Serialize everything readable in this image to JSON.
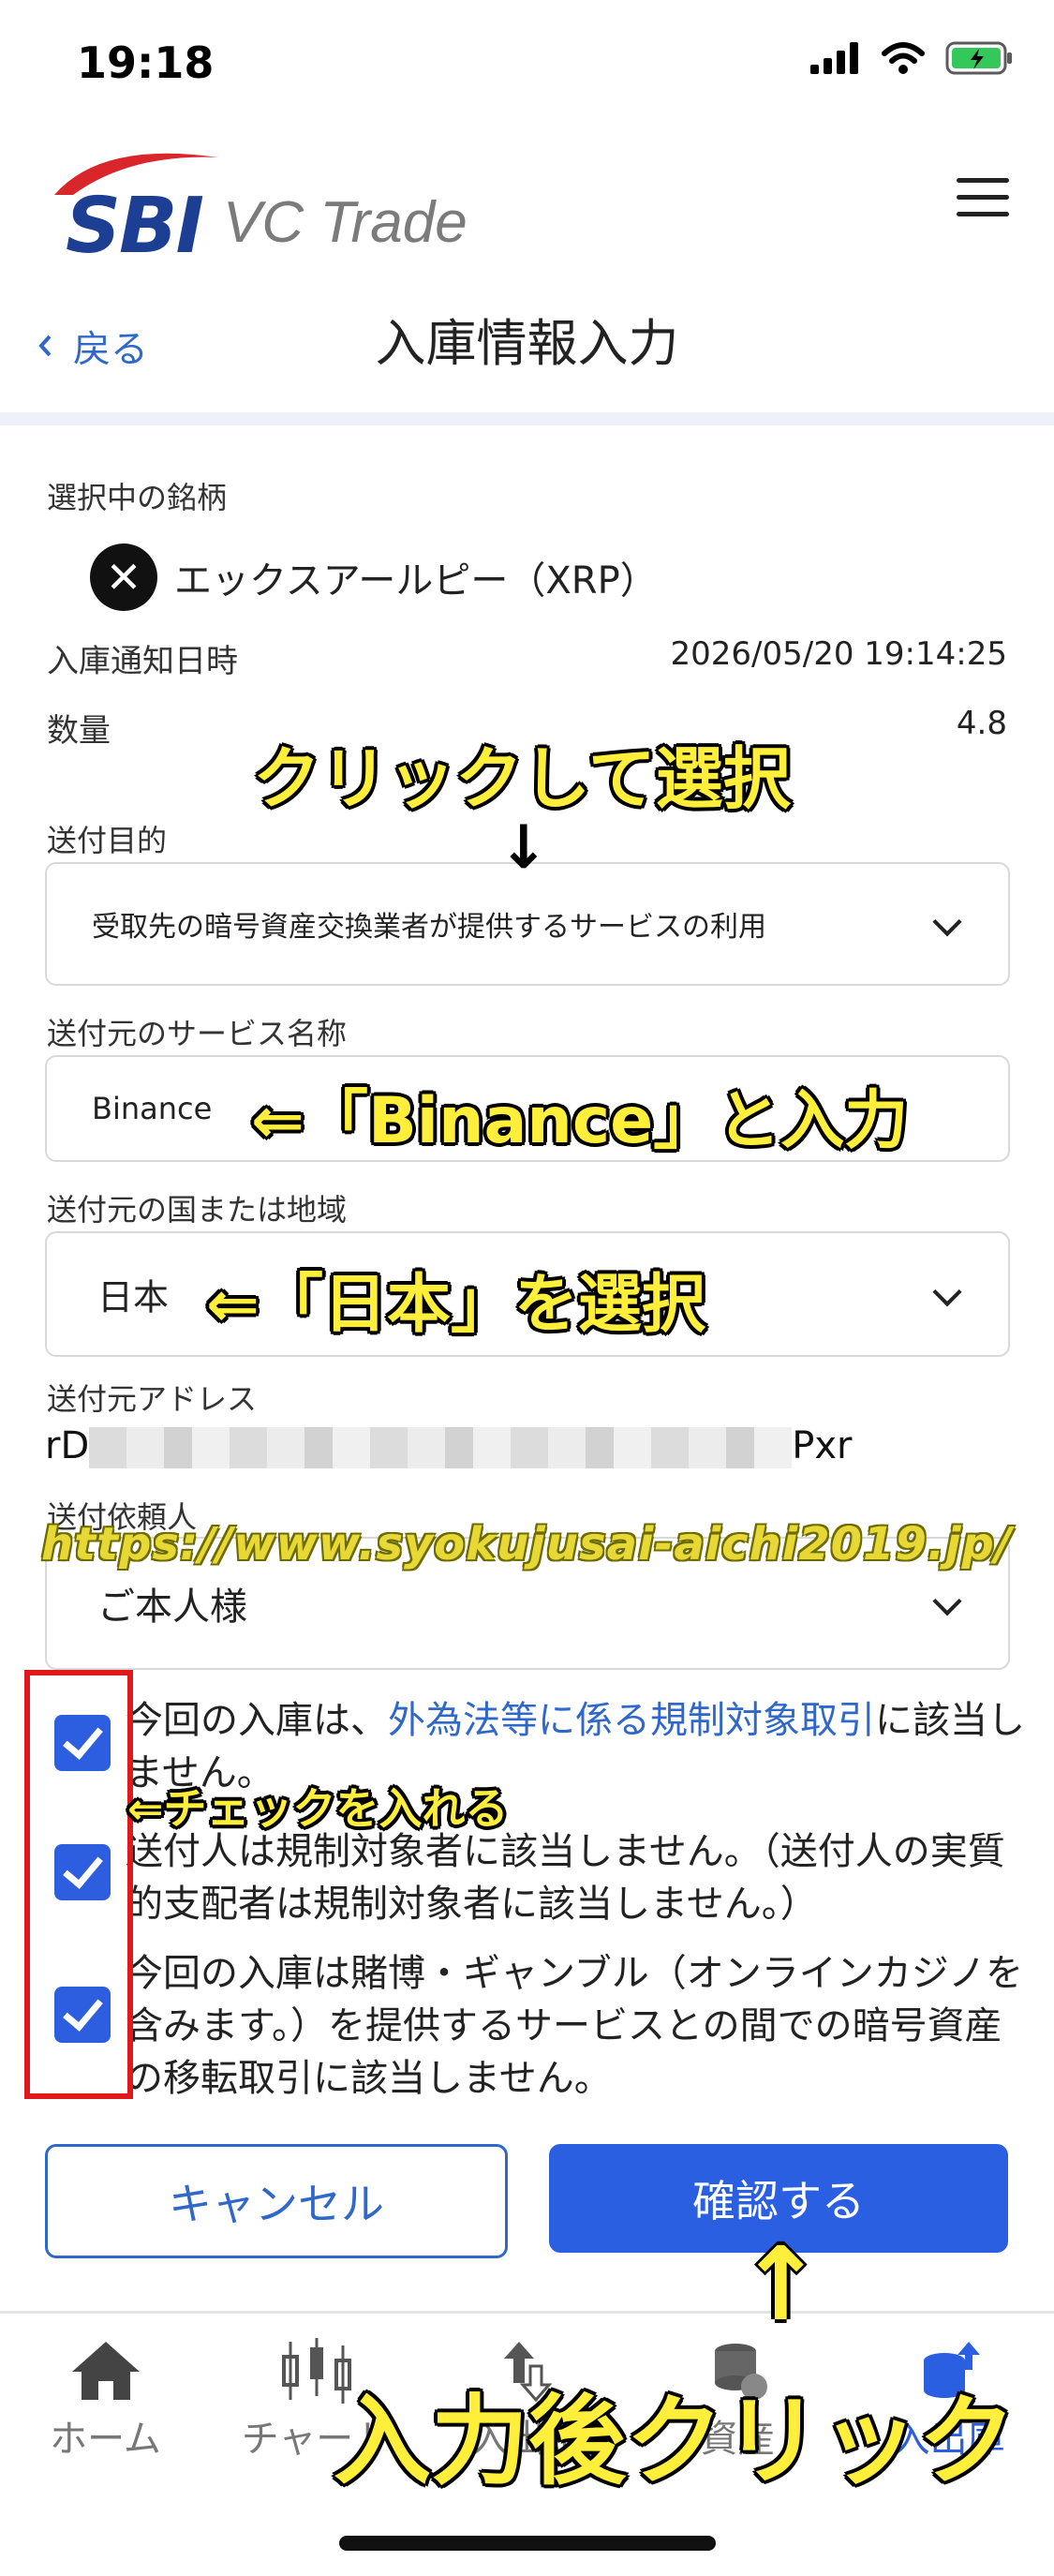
{
  "status_bar": {
    "time": "19:18"
  },
  "header": {
    "logo_sbi": "SBI",
    "logo_vc": "VC Trade",
    "back_label": "戻る",
    "title": "入庫情報入力"
  },
  "form": {
    "selected_label": "選択中の銘柄",
    "coin_name": "エックスアールピー（XRP）",
    "notice_label": "入庫通知日時",
    "notice_value": "2026/05/20 19:14:25",
    "qty_label": "数量",
    "qty_value": "4.8",
    "purpose_label": "送付目的",
    "purpose_value": "受取先の暗号資産交換業者が提供するサービスの利用",
    "service_label": "送付元のサービス名称",
    "service_value": "Binance",
    "country_label": "送付元の国または地域",
    "country_value": "日本",
    "address_label": "送付元アドレス",
    "address_start": "rD",
    "address_end": "Pxr",
    "requester_label": "送付依頼人",
    "requester_value": "ご本人様"
  },
  "checks": [
    {
      "pre": "今回の入庫は、",
      "link": "外為法等に係る規制対象取引",
      "post": "に該当しません。"
    },
    {
      "text": "送付人は規制対象者に該当しません。（送付人の実質的支配者は規制対象者に該当しません。）"
    },
    {
      "text": "今回の入庫は賭博・ギャンブル（オンラインカジノを含みます。）を提供するサービスとの間での暗号資産の移転取引に該当しません。"
    }
  ],
  "buttons": {
    "cancel": "キャンセル",
    "confirm": "確認する"
  },
  "nav": [
    {
      "label": "ホーム",
      "icon": "home-icon"
    },
    {
      "label": "チャート",
      "icon": "chart-icon"
    },
    {
      "label": "入出金",
      "icon": "transfer-icon"
    },
    {
      "label": "資産",
      "icon": "asset-icon"
    },
    {
      "label": "入出庫",
      "icon": "deposit-icon"
    }
  ],
  "annotations": {
    "click_select": "クリックして選択",
    "down_arrow": "↓",
    "enter_binance": "⇐「Binance」と入力",
    "select_japan": "⇐「日本」を選択",
    "check_it": "⇐チェックを入れる",
    "up_arrow": "↑",
    "click_after": "入力後クリック",
    "watermark": "https://www.syokujusai-aichi2019.jp/"
  },
  "colors": {
    "accent": "#2b5fe2",
    "link": "#2f68c8",
    "highlight": "#ffef3a",
    "red": "#e01a1a"
  }
}
